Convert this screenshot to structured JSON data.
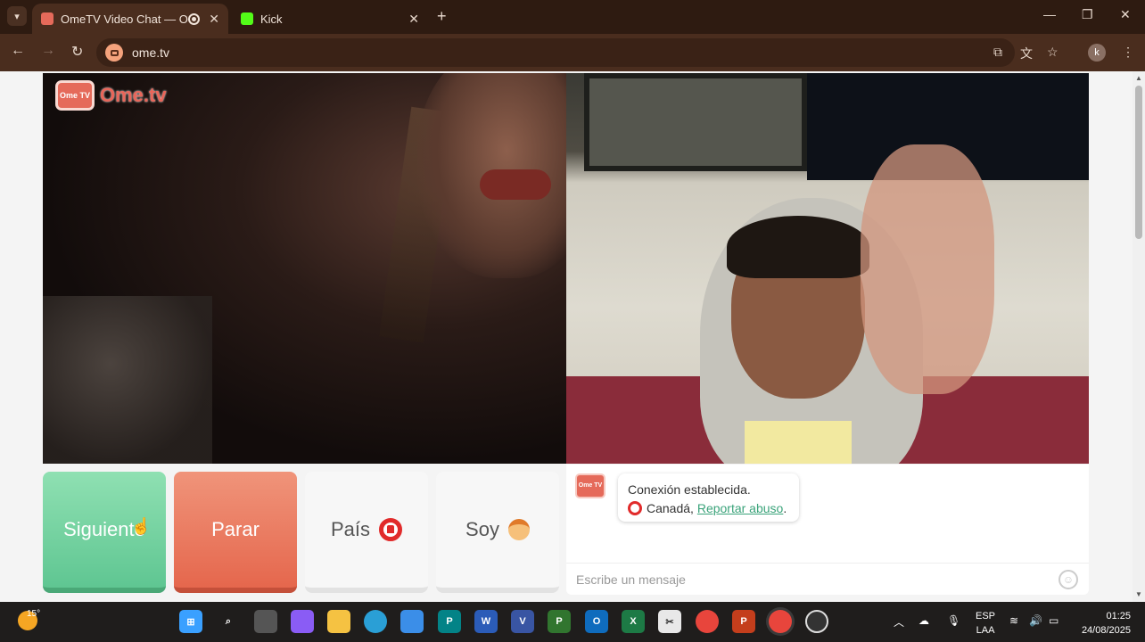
{
  "browser": {
    "tabs": [
      {
        "title": "OmeTV Video Chat — Ome",
        "active": true
      },
      {
        "title": "Kick",
        "active": false
      }
    ],
    "new_tab": "+",
    "url": "ome.tv",
    "profile_initial": "k",
    "colors": {
      "frame": "#2e1b11",
      "toolbar": "#4a2d1e",
      "kick_green": "#53fc18"
    }
  },
  "site": {
    "logo_text": "Ome.tv",
    "logo_badge": "Ome TV",
    "buttons": {
      "next": "Siguiente",
      "stop": "Parar",
      "country": "País",
      "gender": "Soy"
    },
    "chat": {
      "status": "Conexión establecida.",
      "country": "Canadá,",
      "report_link": "Reportar abuso",
      "report_suffix": ".",
      "input_placeholder": "Escribe un mensaje"
    },
    "colors": {
      "next": "#6fd29f",
      "stop": "#e8735a",
      "accent": "#e56a5a"
    }
  },
  "taskbar": {
    "weather_temp": "15°",
    "apps": [
      "start",
      "search",
      "task-view",
      "copilot",
      "file-explorer",
      "edge",
      "store",
      "publisher",
      "word",
      "visio",
      "project",
      "outlook",
      "excel",
      "snipping",
      "chrome",
      "powerpoint",
      "chrome-active",
      "obs"
    ],
    "language_top": "ESP",
    "language_bottom": "LAA",
    "time": "01:25",
    "date": "24/08/2025"
  }
}
